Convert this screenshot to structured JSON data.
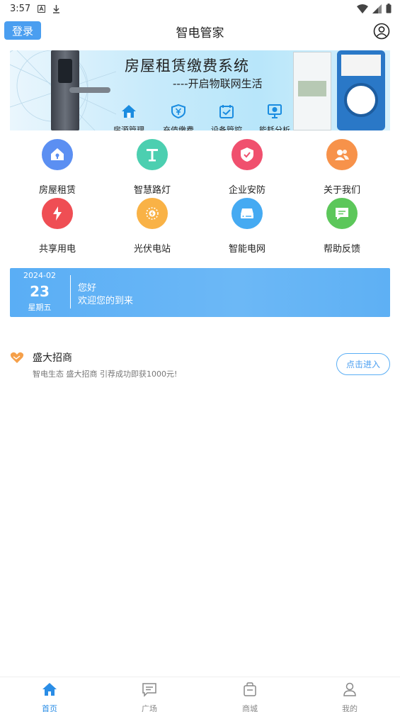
{
  "status_bar": {
    "time": "3:57"
  },
  "header": {
    "login_label": "登录",
    "title": "智电管家"
  },
  "banner": {
    "title": "房屋租赁缴费系统",
    "subtitle": "----开启物联网生活",
    "items": [
      {
        "label": "房源管理",
        "icon": "house-icon"
      },
      {
        "label": "充值缴费",
        "icon": "yen-shield-icon"
      },
      {
        "label": "设备管控",
        "icon": "calendar-check-icon"
      },
      {
        "label": "能耗分析",
        "icon": "monitor-chart-icon"
      }
    ]
  },
  "grid": [
    {
      "label": "房屋租赁",
      "icon": "house-key-icon",
      "color": "#5b8ff2"
    },
    {
      "label": "智慧路灯",
      "icon": "street-lamp-icon",
      "color": "#4ccfb0"
    },
    {
      "label": "企业安防",
      "icon": "shield-check-icon",
      "color": "#f0506e"
    },
    {
      "label": "关于我们",
      "icon": "people-icon",
      "color": "#f7924a"
    },
    {
      "label": "共享用电",
      "icon": "lightning-icon",
      "color": "#ef4e54"
    },
    {
      "label": "光伏电站",
      "icon": "sun-icon",
      "color": "#f9b246"
    },
    {
      "label": "智能电网",
      "icon": "server-icon",
      "color": "#45aaf2"
    },
    {
      "label": "帮助反馈",
      "icon": "chat-icon",
      "color": "#5cc75a"
    }
  ],
  "date_card": {
    "year_month": "2024-02",
    "day": "23",
    "weekday": "星期五",
    "greeting": "您好",
    "welcome": "欢迎您的到来"
  },
  "promo": {
    "title": "盛大招商",
    "description": "智电生态 盛大招商 引荐成功即获1000元!",
    "button_label": "点击进入"
  },
  "tabbar": [
    {
      "label": "首页",
      "icon": "home-icon",
      "active": true
    },
    {
      "label": "广场",
      "icon": "message-square-icon",
      "active": false
    },
    {
      "label": "商城",
      "icon": "shopping-bag-icon",
      "active": false
    },
    {
      "label": "我的",
      "icon": "user-icon",
      "active": false
    }
  ],
  "colors": {
    "accent": "#4a9ef0",
    "active_tab": "#2a8de6"
  }
}
